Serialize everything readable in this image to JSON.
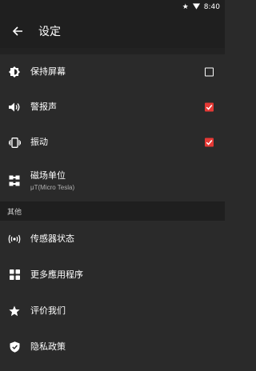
{
  "status_bar": {
    "time": "8:40",
    "icons": [
      "star-icon",
      "wifi-icon"
    ]
  },
  "app_bar": {
    "title": "设定",
    "back_icon": "arrow-left-icon"
  },
  "settings": [
    {
      "label": "保持屏幕",
      "icon": "brightness-icon",
      "checked": false
    },
    {
      "label": "警报声",
      "icon": "speaker-icon",
      "checked": true
    },
    {
      "label": "振动",
      "icon": "vibrate-icon",
      "checked": true
    },
    {
      "label": "磁场单位",
      "sub": "μT(Micro Tesla)",
      "icon": "magnet-units-icon"
    }
  ],
  "other_header": "其他",
  "other": [
    {
      "label": "传感器状态",
      "icon": "sensor-broadcast-icon"
    },
    {
      "label": "更多應用程序",
      "icon": "apps-grid-icon"
    },
    {
      "label": "评价我们",
      "icon": "star-icon"
    },
    {
      "label": "隐私政策",
      "icon": "shield-icon"
    }
  ],
  "colors": {
    "accent": "#e53935",
    "background": "#2a2a2a",
    "bar": "#1f1f1f"
  }
}
